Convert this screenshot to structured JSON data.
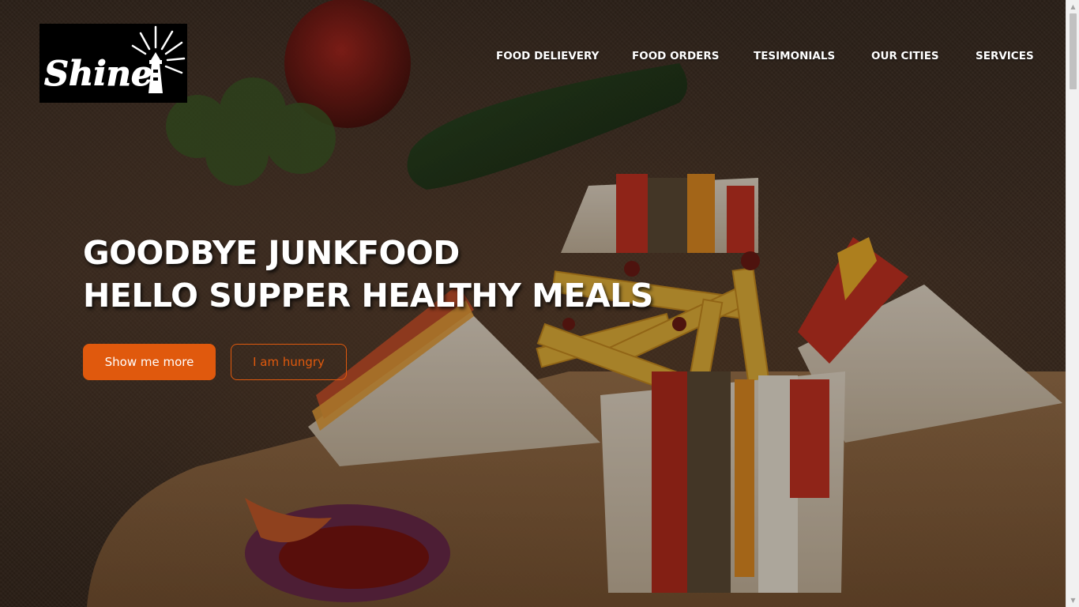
{
  "brand": {
    "logo_text": "Shine",
    "logo_icon": "lighthouse-icon"
  },
  "nav": {
    "items": [
      {
        "label": "FOOD DELIEVERY"
      },
      {
        "label": "FOOD ORDERS"
      },
      {
        "label": "TESIMONIALS"
      },
      {
        "label": "OUR CITIES"
      },
      {
        "label": "SERVICES"
      }
    ]
  },
  "hero": {
    "headline_line1": "GOODBYE JUNKFOOD",
    "headline_line2": "HELLO SUPPER HEALTHY MEALS",
    "primary_button": "Show me more",
    "secondary_button": "I am hungry",
    "image": "club-sandwiches-and-fries-photo"
  },
  "colors": {
    "accent": "#e0590d",
    "text": "#ffffff",
    "logo_bg": "#000000"
  }
}
